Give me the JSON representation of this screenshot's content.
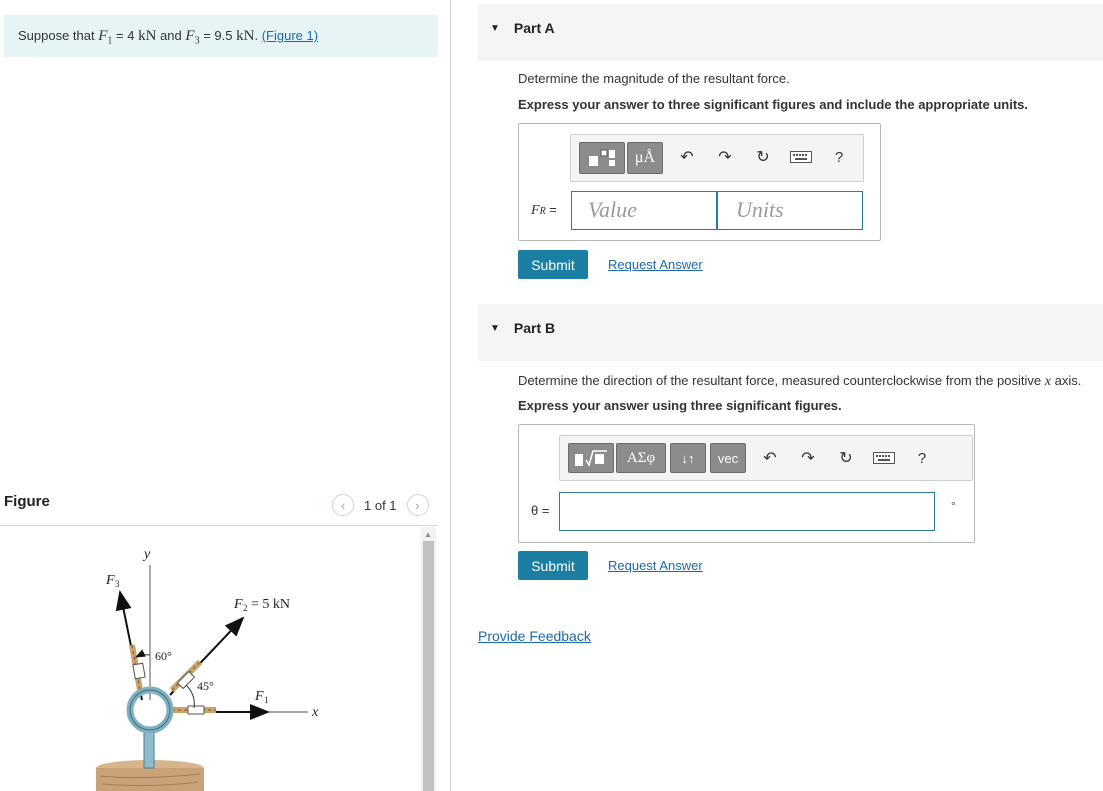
{
  "problem": {
    "prefix": "Suppose that",
    "f1_symbol": "F",
    "f1_sub": "1",
    "f1_eq": "= 4",
    "f1_unit": "kN",
    "and": "and",
    "f3_symbol": "F",
    "f3_sub": "3",
    "f3_eq": "= 9.5",
    "f3_unit": "kN",
    "period": ".",
    "figure_link": "(Figure 1)"
  },
  "figure": {
    "header": "Figure",
    "pager_text": "1 of 1",
    "prev_icon": "chevron-left-icon",
    "next_icon": "chevron-right-icon",
    "labels": {
      "y_axis": "y",
      "x_axis": "x",
      "f3": "F",
      "f3_sub": "3",
      "f2": "F",
      "f2_sub": "2",
      "f2_value": "= 5 kN",
      "f1": "F",
      "f1_sub": "1",
      "angle_60": "60°",
      "angle_45": "45°"
    },
    "colors": {
      "rope": "#c9a36a",
      "ring": "#7fb0c0",
      "base": "#c9a27a"
    }
  },
  "part_a": {
    "title": "Part A",
    "question": "Determine the magnitude of the resultant force.",
    "instruction": "Express your answer to three significant figures and include the appropriate units.",
    "toolbar": {
      "templates_icon": "templates-icon",
      "units_button": "μÅ",
      "undo_icon": "undo-icon",
      "redo_icon": "redo-icon",
      "reset_icon": "reset-icon",
      "keyboard_icon": "keyboard-icon",
      "help": "?"
    },
    "label": "F",
    "label_sub": "R",
    "label_eq": "=",
    "value_placeholder": "Value",
    "units_placeholder": "Units",
    "submit": "Submit",
    "request_answer": "Request Answer"
  },
  "part_b": {
    "title": "Part B",
    "question_prefix": "Determine the direction of the resultant force, measured counterclockwise from the positive",
    "question_var": "x",
    "question_suffix": "axis.",
    "instruction": "Express your answer using three significant figures.",
    "toolbar": {
      "templates_icon": "templates-icon",
      "greek_button": "ΑΣφ",
      "arrows_button": "↓↑",
      "vec_button": "vec",
      "undo_icon": "undo-icon",
      "redo_icon": "redo-icon",
      "reset_icon": "reset-icon",
      "keyboard_icon": "keyboard-icon",
      "help": "?"
    },
    "label": "θ =",
    "unit": "°",
    "submit": "Submit",
    "request_answer": "Request Answer"
  },
  "feedback": "Provide Feedback",
  "colors": {
    "accent": "#1a7fa2",
    "problem_bg": "#e6f4f5",
    "link": "#1a6aa8"
  }
}
